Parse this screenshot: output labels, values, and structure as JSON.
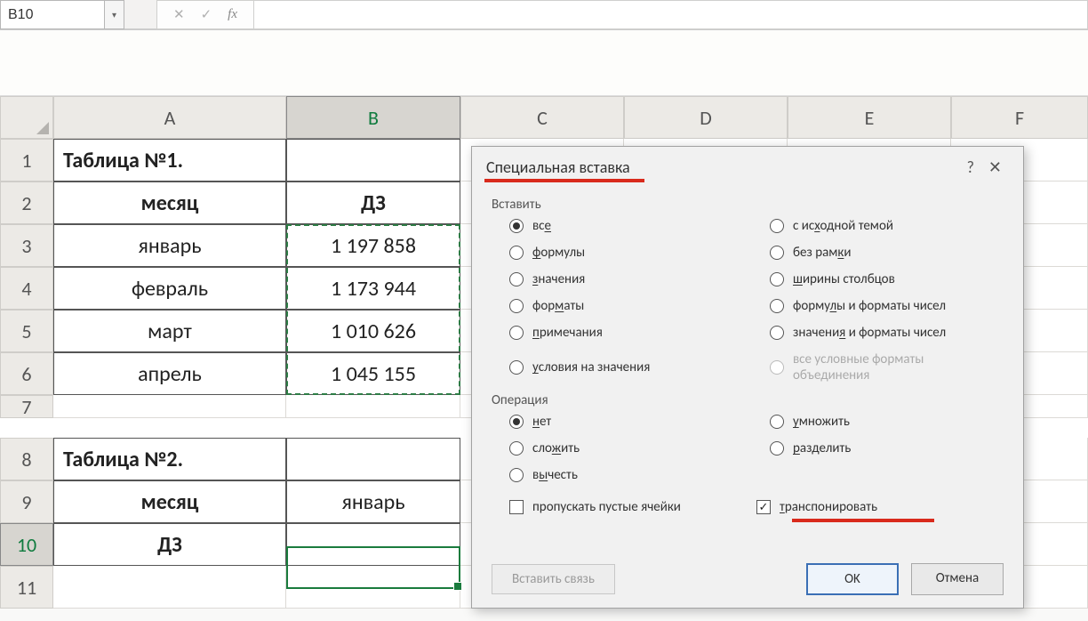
{
  "name_box": "B10",
  "columns": [
    "A",
    "B",
    "C",
    "D",
    "E",
    "F"
  ],
  "rows": [
    "1",
    "2",
    "3",
    "4",
    "5",
    "6",
    "7",
    "8",
    "9",
    "10",
    "11"
  ],
  "cells": {
    "A1": "Таблица №1.",
    "A2": "месяц",
    "B2": "ДЗ",
    "A3": "январь",
    "B3": "1 197 858",
    "A4": "февраль",
    "B4": "1 173 944",
    "A5": "март",
    "B5": "1 010 626",
    "A6": "апрель",
    "B6": "1 045 155",
    "A8": "Таблица №2.",
    "A9": "месяц",
    "B9": "январь",
    "A10": "ДЗ"
  },
  "dialog": {
    "title": "Специальная вставка",
    "group_insert": "Вставить",
    "insert_options": {
      "all": "все",
      "formulas": "формулы",
      "values": "значения",
      "formats": "форматы",
      "comments": "примечания",
      "validation": "условия на значения",
      "source_theme": "с исходной темой",
      "no_border": "без рамки",
      "col_widths": "ширины столбцов",
      "formulas_numfmt": "формулы и форматы чисел",
      "values_numfmt": "значения и форматы чисел",
      "cond_formats": "все условные форматы объединения"
    },
    "group_operation": "Операция",
    "op_options": {
      "none": "нет",
      "add": "сложить",
      "subtract": "вычесть",
      "multiply": "умножить",
      "divide": "разделить"
    },
    "skip_blanks": "пропускать пустые ячейки",
    "transpose": "транспонировать",
    "paste_link": "Вставить связь",
    "ok": "OK",
    "cancel": "Отмена"
  },
  "chart_data": {
    "type": "table",
    "title": "Таблица №1.",
    "columns": [
      "месяц",
      "ДЗ"
    ],
    "rows": [
      [
        "январь",
        1197858
      ],
      [
        "февраль",
        1173944
      ],
      [
        "март",
        1010626
      ],
      [
        "апрель",
        1045155
      ]
    ]
  }
}
